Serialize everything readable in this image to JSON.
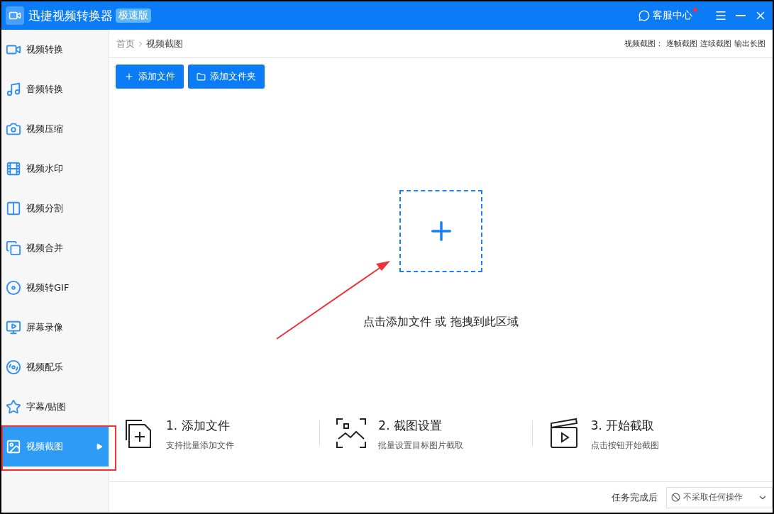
{
  "window": {
    "title": "迅捷视频转换器",
    "edition_badge": "极速版",
    "support": {
      "label": "客服中心",
      "notification": true
    }
  },
  "sidebar": {
    "items": [
      {
        "label": "视频转换",
        "selected": false
      },
      {
        "label": "音频转换",
        "selected": false
      },
      {
        "label": "视频压缩",
        "selected": false
      },
      {
        "label": "视频水印",
        "selected": false
      },
      {
        "label": "视频分割",
        "selected": false
      },
      {
        "label": "视频合并",
        "selected": false
      },
      {
        "label": "视频转GIF",
        "selected": false
      },
      {
        "label": "屏幕录像",
        "selected": false
      },
      {
        "label": "视频配乐",
        "selected": false
      },
      {
        "label": "字幕/贴图",
        "selected": false
      },
      {
        "label": "视频截图",
        "selected": true
      }
    ]
  },
  "breadcrumb": [
    "首页",
    "视频截图"
  ],
  "mode_links": {
    "label": "视频截图：",
    "options": [
      "逐帧截图",
      "连续截图",
      "输出长图"
    ]
  },
  "toolbar": [
    {
      "kind": "file",
      "label": "添加文件"
    },
    {
      "kind": "folder",
      "label": "添加文件夹"
    }
  ],
  "drop_zone": {
    "hint": "点击添加文件 或 拖拽到此区域"
  },
  "steps": [
    {
      "kind": "add",
      "title": "1. 添加文件",
      "desc": "支持批量添加文件"
    },
    {
      "kind": "settings",
      "title": "2. 截图设置",
      "desc": "批量设置目标图片截取"
    },
    {
      "kind": "start",
      "title": "3. 开始截取",
      "desc": "点击按钮开始截图"
    }
  ],
  "footer": {
    "label": "任务完成后",
    "select_value": "不采取任何操作"
  }
}
